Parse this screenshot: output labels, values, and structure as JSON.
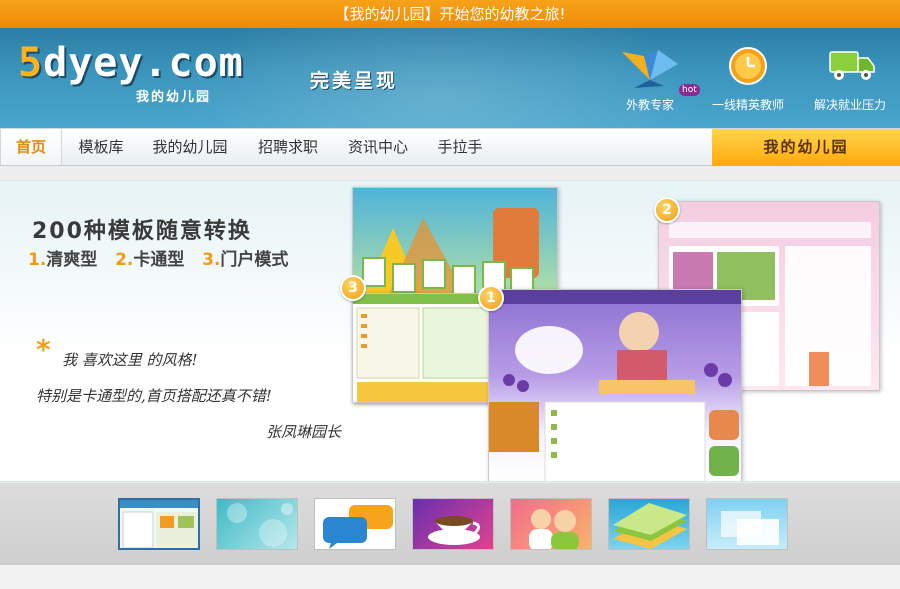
{
  "topbar": {
    "text": "【我的幼儿园】开始您的幼教之旅!"
  },
  "header": {
    "logo_five": "5",
    "logo_rest": "dyey.com",
    "logo_sub": "我的幼儿园",
    "slogan": "完美呈现",
    "icons": [
      {
        "label": "外教专家",
        "icon": "origami-crane-icon",
        "badge": "hot"
      },
      {
        "label": "一线精英教师",
        "icon": "clock-icon"
      },
      {
        "label": "解决就业压力",
        "icon": "truck-icon"
      }
    ]
  },
  "nav": {
    "items": [
      "首页",
      "模板库",
      "我的幼儿园",
      "招聘求职",
      "资讯中心",
      "手拉手"
    ],
    "active_index": 0,
    "right_button": "我的幼儿园"
  },
  "banner": {
    "title": "200种模板随意转换",
    "types": [
      {
        "num": "1.",
        "label": "清爽型"
      },
      {
        "num": "2.",
        "label": "卡通型"
      },
      {
        "num": "3.",
        "label": "门户模式"
      }
    ],
    "quote_lines": [
      "我 喜欢这里 的风格!",
      "特别是卡通型的,首页搭配还真不错!",
      "张凤琳园长"
    ],
    "badges": [
      "1",
      "2",
      "3"
    ]
  },
  "thumbnails": {
    "items": [
      {
        "name": "thumb-template-preview",
        "selected": true
      },
      {
        "name": "thumb-teal-bokeh"
      },
      {
        "name": "thumb-chat-bubbles"
      },
      {
        "name": "thumb-coffee-cup"
      },
      {
        "name": "thumb-users"
      },
      {
        "name": "thumb-green-layers"
      },
      {
        "name": "thumb-windows"
      }
    ]
  },
  "colors": {
    "accent": "#f39a12",
    "header": "#3b95bd",
    "nav_right": "#ffb21c"
  }
}
